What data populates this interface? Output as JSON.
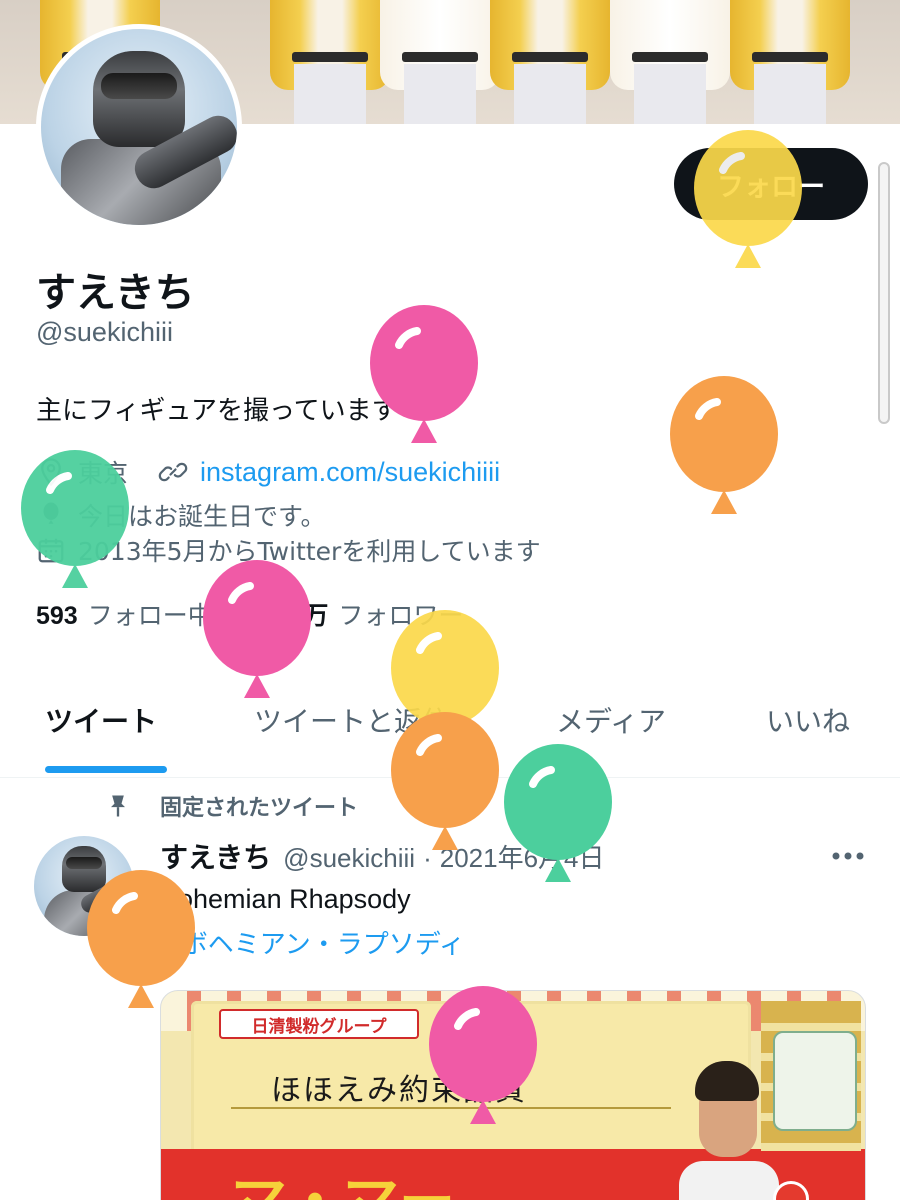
{
  "profile": {
    "display_name": "すえきち",
    "handle": "@suekichiii",
    "bio": "主にフィギュアを撮っています",
    "location": "東京",
    "website": "instagram.com/suekichiiii",
    "birthday": "今日はお誕生日です。",
    "joined": "2013年5月からTwitterを利用しています",
    "following_count": "593",
    "following_label": "フォロー中",
    "followers_count": "17.5万",
    "followers_label": "フォロワー"
  },
  "actions": {
    "follow_label": "フォロー"
  },
  "tabs": [
    {
      "label": "ツイート",
      "active": true
    },
    {
      "label": "ツイートと返信",
      "active": false
    },
    {
      "label": "メディア",
      "active": false
    },
    {
      "label": "いいね",
      "active": false
    }
  ],
  "pinned_tweet": {
    "pinned_label": "固定されたツイート",
    "author_name": "すえきち",
    "author_handle": "@suekichiii",
    "separator": "·",
    "date": "2021年6月4日",
    "text_line1": "Bohemian Rhapsody",
    "hashtag": "#ボヘミアン・ラプソディ",
    "media": {
      "brand_text": "日清製粉グループ",
      "headline": "ほほえみ約束品質",
      "product_text": "マ・マー"
    }
  },
  "colors": {
    "accent": "#1d9bf0",
    "text_primary": "#0f1419",
    "text_secondary": "#536471",
    "follow_button_bg": "#0f1419",
    "balloon_pink": "#f05aa6",
    "balloon_orange": "#f7a04b",
    "balloon_yellow": "#fbd94a",
    "balloon_green": "#4ccf9d"
  },
  "icons": {
    "location": "location-pin-icon",
    "link": "link-icon",
    "birthday": "balloon-icon",
    "joined": "calendar-icon",
    "pin": "pin-icon",
    "more": "more-icon"
  }
}
